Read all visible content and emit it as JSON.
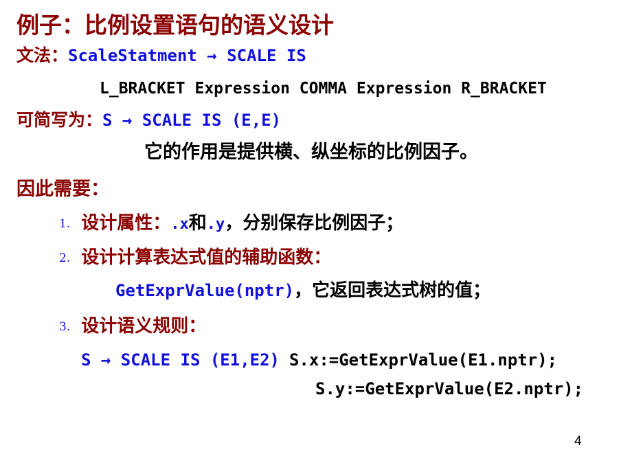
{
  "slide": {
    "background_color": "#FFFFFF",
    "page_number": "4",
    "colors": {
      "heading_red": "#8B0000",
      "code_blue": "#1111DD",
      "body_black": "#000000"
    },
    "title": "例子：比例设置语句的语义设计",
    "grammar": {
      "label": "文法：",
      "code": "ScaleStatment  →  SCALE IS",
      "continuation": "L_BRACKET Expression COMMA Expression R_BRACKET"
    },
    "shorthand": {
      "label": "可简写为：",
      "code": "S → SCALE IS (E,E)"
    },
    "purpose": "它的作用是提供横、纵坐标的比例因子。",
    "need_heading": "因此需要：",
    "items": [
      {
        "number": "1.",
        "title": "设计属性：",
        "code_x": ".x",
        "conjunction": "和",
        "code_y": ".y",
        "tail": "，分别保存比例因子；"
      },
      {
        "number": "2.",
        "title": "设计计算表达式值的辅助函数：",
        "detail_code": "GetExprValue(nptr)",
        "detail_tail": "，它返回表达式树的值；"
      },
      {
        "number": "3.",
        "title": "设计语义规则：",
        "rule_production": "S → SCALE IS (E1,E2)",
        "rule_action_1": "S.x:=GetExprValue(E1.nptr);",
        "rule_action_2": "S.y:=GetExprValue(E2.nptr);"
      }
    ]
  }
}
